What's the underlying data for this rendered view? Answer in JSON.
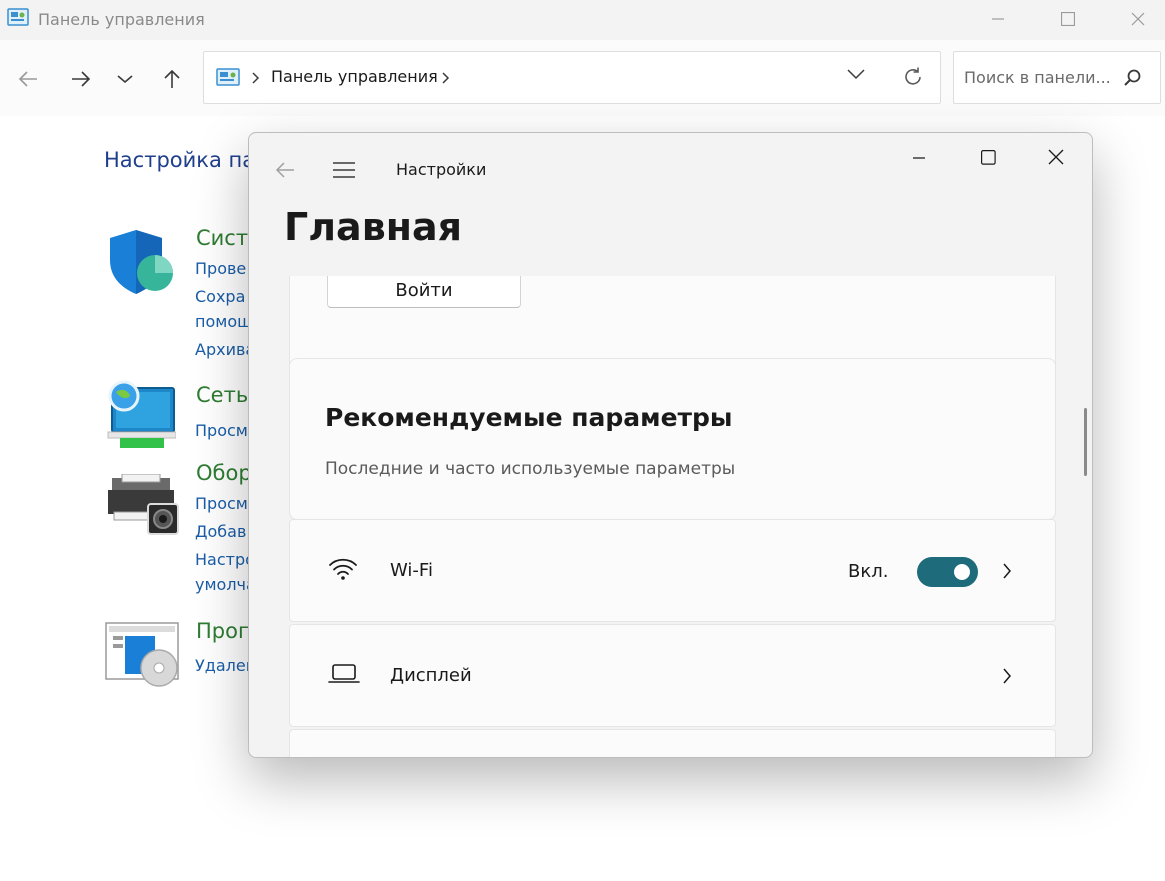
{
  "control_panel": {
    "window_title": "Панель управления",
    "address": {
      "path_label": "Панель управления"
    },
    "search": {
      "placeholder": "Поиск в панели..."
    },
    "heading": "Настройка па",
    "categories": [
      {
        "title": "Систе",
        "links": [
          "Прове",
          "Сохра",
          "помощ",
          "Архива"
        ],
        "icon": "shield-icon"
      },
      {
        "title": "Сеть",
        "links": [
          "Просм"
        ],
        "icon": "network-icon"
      },
      {
        "title": "Обор",
        "links": [
          "Просм",
          "Добав",
          "Настро",
          "умолча"
        ],
        "icon": "printer-icon"
      },
      {
        "title": "Прог",
        "links": [
          "Удален"
        ],
        "icon": "programs-icon"
      }
    ]
  },
  "settings": {
    "app_name": "Настройки",
    "page_title": "Главная",
    "signin_label": "Войти",
    "recommended": {
      "title": "Рекомендуемые параметры",
      "subtitle": "Последние и часто используемые параметры"
    },
    "rows": [
      {
        "icon": "wifi-icon",
        "label": "Wi-Fi",
        "status": "Вкл.",
        "toggle_on": true
      },
      {
        "icon": "display-icon",
        "label": "Дисплей"
      }
    ]
  },
  "colors": {
    "toggle_on": "#1e6b7b",
    "link": "#1a5ea8",
    "category_title": "#2e7d32",
    "heading": "#1f3f8c"
  }
}
